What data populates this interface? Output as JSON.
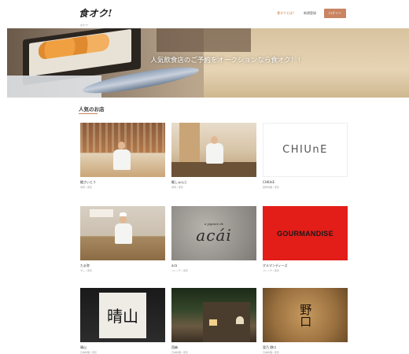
{
  "header": {
    "logo": "食オク!",
    "logo_sub": "",
    "nav": {
      "link1": "食オクとは？",
      "link2": "新規登録",
      "login": "ログイン"
    },
    "breadcrumb": "食オク!"
  },
  "hero": {
    "headline": "人気飲食店のご予約をオークションなら食オク！！"
  },
  "section": {
    "title": "人気のお店"
  },
  "restaurants": [
    {
      "name": "鮨さいとう",
      "meta": "寿司 / 東京",
      "image_text": ""
    },
    {
      "name": "鮨しゅんじ",
      "meta": "寿司 / 東京",
      "image_text": ""
    },
    {
      "name": "CHIUnE",
      "meta": "創作料理 / 東京",
      "image_text": "CHIUnE"
    },
    {
      "name": "たま弥",
      "meta": "すし / 東京",
      "image_text": ""
    },
    {
      "name": "acá",
      "meta": "フレンチ / 東京",
      "image_text_small": "a yiganie de",
      "image_text": "acái"
    },
    {
      "name": "グルマンディーズ",
      "meta": "フレンチ / 東京",
      "image_text": "GOURMANDISE"
    },
    {
      "name": "晴山",
      "meta": "日本料理 / 東京",
      "image_text": "晴山"
    },
    {
      "name": "西麻",
      "meta": "日本料理 / 東京",
      "image_text": ""
    },
    {
      "name": "里乃 野口",
      "meta": "日本料理 / 東京",
      "image_text": "野口"
    }
  ]
}
